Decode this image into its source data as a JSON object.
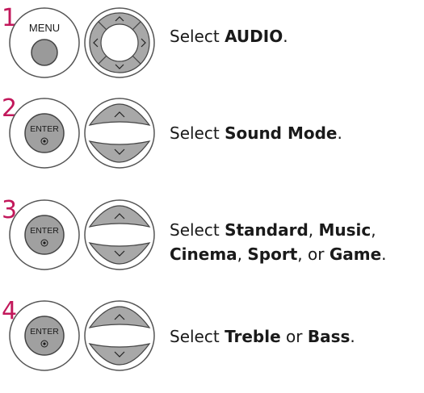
{
  "accent_color": "#c2185b",
  "steps": [
    {
      "number": "1",
      "button_label": "MENU",
      "pad": "4-way",
      "lines": [
        [
          {
            "t": "Select ",
            "b": false
          },
          {
            "t": "AUDIO",
            "b": true
          },
          {
            "t": ".",
            "b": false
          }
        ]
      ]
    },
    {
      "number": "2",
      "button_label": "ENTER",
      "pad": "up-down",
      "lines": [
        [
          {
            "t": "Select ",
            "b": false
          },
          {
            "t": "Sound Mode",
            "b": true
          },
          {
            "t": ".",
            "b": false
          }
        ]
      ]
    },
    {
      "number": "3",
      "button_label": "ENTER",
      "pad": "up-down",
      "lines": [
        [
          {
            "t": "Select ",
            "b": false
          },
          {
            "t": "Standard",
            "b": true
          },
          {
            "t": ", ",
            "b": false
          },
          {
            "t": "Music",
            "b": true
          },
          {
            "t": ",",
            "b": false
          }
        ],
        [
          {
            "t": "Cinema",
            "b": true
          },
          {
            "t": ", ",
            "b": false
          },
          {
            "t": "Sport",
            "b": true
          },
          {
            "t": ", or ",
            "b": false
          },
          {
            "t": "Game",
            "b": true
          },
          {
            "t": ".",
            "b": false
          }
        ]
      ]
    },
    {
      "number": "4",
      "button_label": "ENTER",
      "pad": "up-down",
      "lines": [
        [
          {
            "t": "Select ",
            "b": false
          },
          {
            "t": "Treble",
            "b": true
          },
          {
            "t": " or ",
            "b": false
          },
          {
            "t": "Bass",
            "b": true
          },
          {
            "t": ".",
            "b": false
          }
        ]
      ]
    }
  ]
}
